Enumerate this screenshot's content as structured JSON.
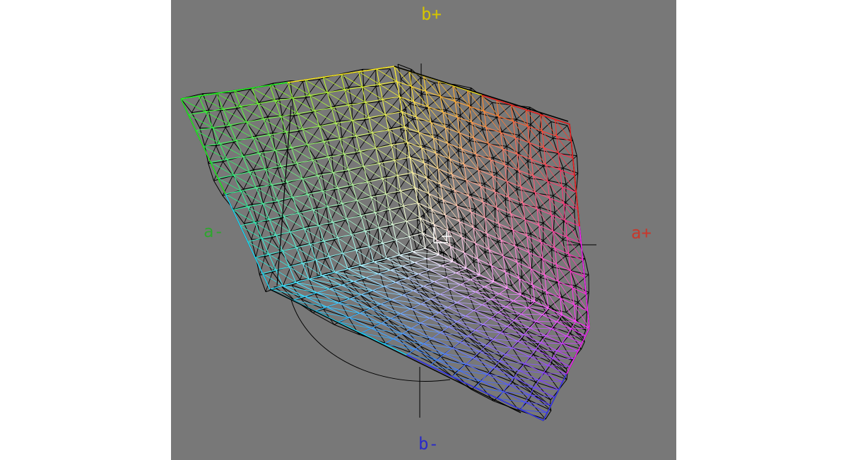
{
  "axes": {
    "b_plus": {
      "label": "b+",
      "color": "#d4c400"
    },
    "a_plus": {
      "label": "a+",
      "color": "#c8382c"
    },
    "a_minus": {
      "label": "a-",
      "color": "#2fa52f"
    },
    "b_minus": {
      "label": "b-",
      "color": "#2a2ac8"
    }
  },
  "colors": {
    "background": "#787878",
    "page": "#ffffff",
    "wire_dark": "#000000",
    "center_marker": "#ffffff"
  },
  "gamut_corners": {
    "green": "#22ff22",
    "yellow": "#ffee22",
    "red": "#ff2222",
    "magenta": "#ff22ff",
    "blue": "#3a3aff",
    "cyan": "#22e0ff",
    "white": "#ffffff"
  }
}
